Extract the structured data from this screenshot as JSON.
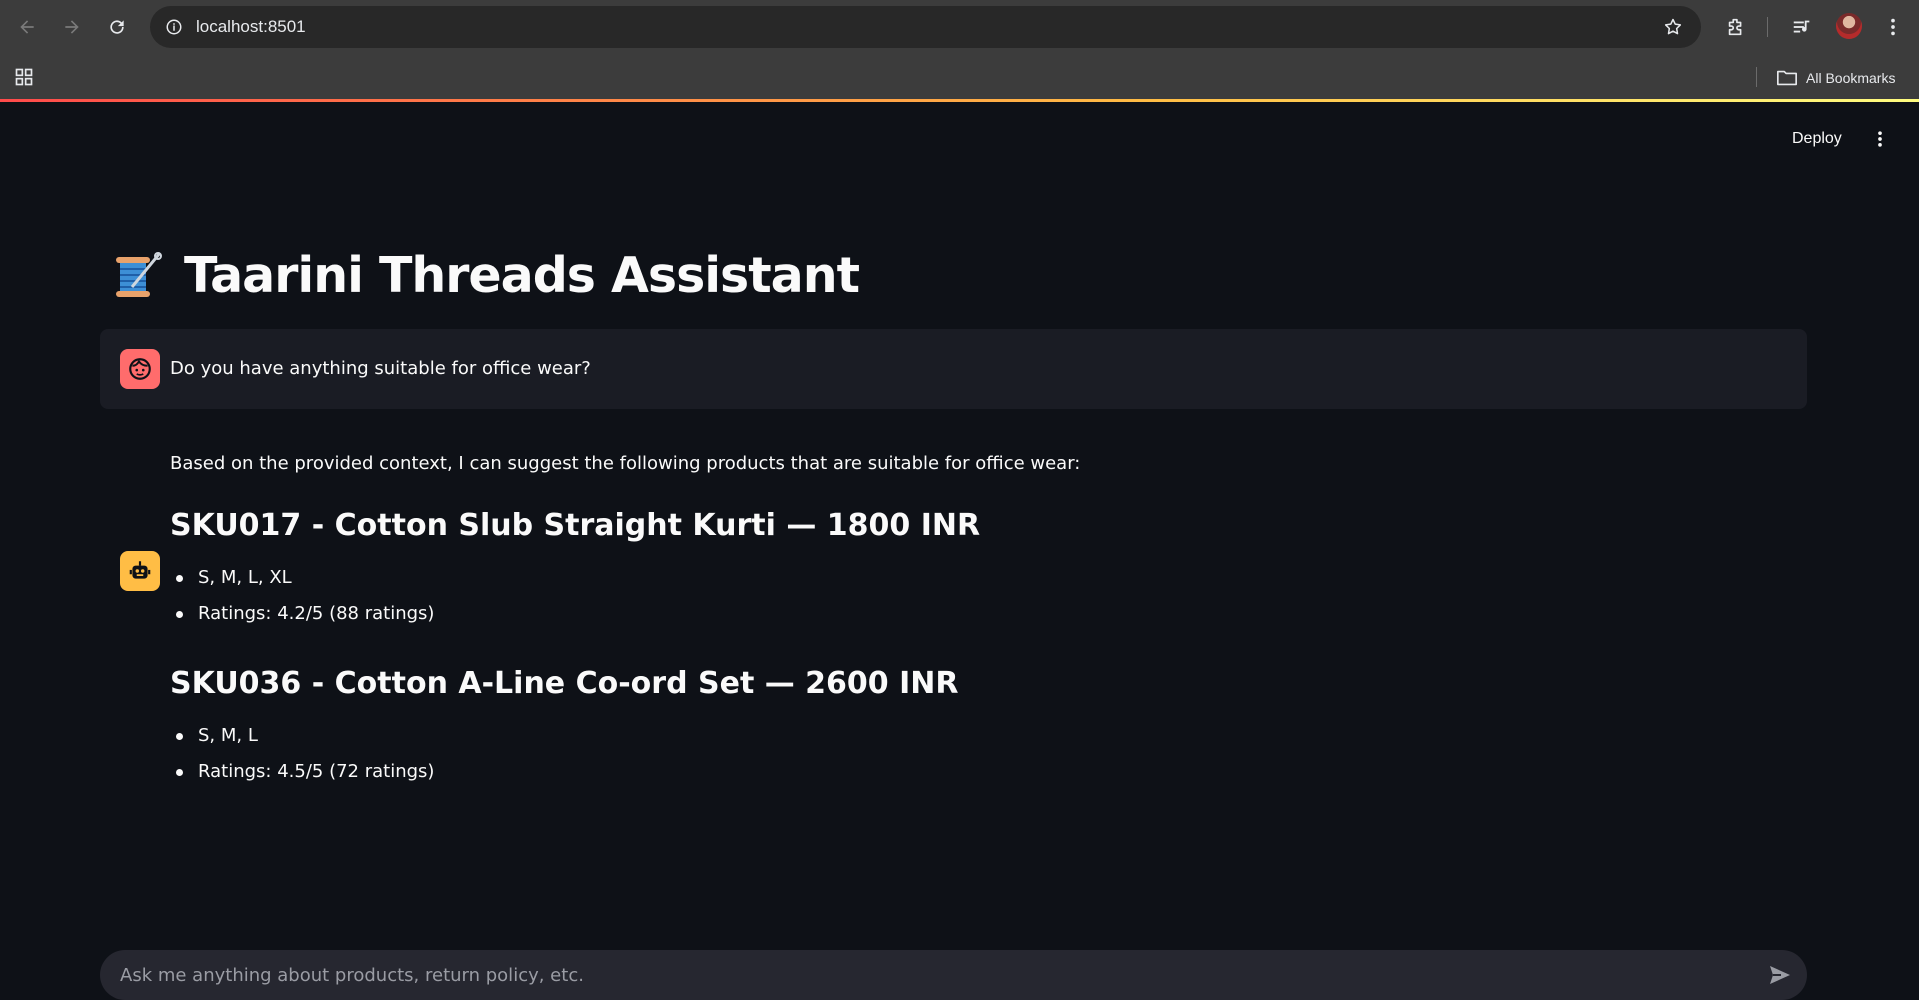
{
  "browser": {
    "url": "localhost:8501",
    "bookmarks_label": "All Bookmarks"
  },
  "app": {
    "deploy_label": "Deploy",
    "title": "Taarini Threads Assistant",
    "title_icon": "spool-of-thread-emoji"
  },
  "chat": {
    "user_message": "Do you have anything suitable for office wear?",
    "assistant": {
      "intro": "Based on the provided context, I can suggest the following products that are suitable for office wear:",
      "products": [
        {
          "heading": "SKU017 - Cotton Slub Straight Kurti — 1800 INR",
          "bullets": [
            "S, M, L, XL",
            "Ratings: 4.2/5 (88 ratings)"
          ]
        },
        {
          "heading": "SKU036 - Cotton A-Line Co-ord Set — 2600 INR",
          "bullets": [
            "S, M, L",
            "Ratings: 4.5/5 (72 ratings)"
          ]
        }
      ]
    },
    "input_placeholder": "Ask me anything about products, return policy, etc."
  },
  "colors": {
    "app_bg": "#0e1117",
    "user_avatar": "#ff6c6c",
    "assistant_avatar": "#ffbd45",
    "chat_input_bg": "#262730"
  }
}
